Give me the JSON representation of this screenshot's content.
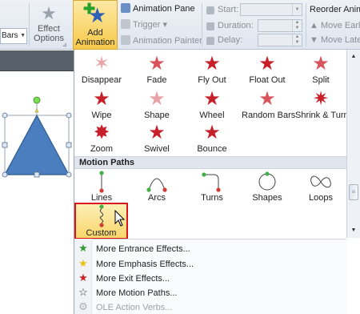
{
  "ribbon": {
    "bars_value": "Bars",
    "effect_options": {
      "line1": "Effect",
      "line2": "Options"
    },
    "add_animation": {
      "line1": "Add",
      "line2": "Animation"
    },
    "animation_pane": "Animation Pane",
    "trigger": "Trigger",
    "animation_painter": "Animation Painter",
    "start_label": "Start:",
    "duration_label": "Duration:",
    "delay_label": "Delay:",
    "reorder_label": "Reorder Anima",
    "move_earlier": "Move Earlie",
    "move_later": "Move Later"
  },
  "gallery": {
    "row1": [
      "Disappear",
      "Fade",
      "Fly Out",
      "Float Out",
      "Split"
    ],
    "row2": [
      "Wipe",
      "Shape",
      "Wheel",
      "Random Bars",
      "Shrink & Turn"
    ],
    "row3": [
      "Zoom",
      "Swivel",
      "Bounce"
    ],
    "motion_paths_header": "Motion Paths",
    "motion_paths": [
      "Lines",
      "Arcs",
      "Turns",
      "Shapes",
      "Loops"
    ],
    "custom_path": "Custom Path"
  },
  "menu": {
    "items": [
      {
        "label": "More Entrance Effects...",
        "icon": "green-star-icon",
        "enabled": true
      },
      {
        "label": "More Emphasis Effects...",
        "icon": "yellow-star-icon",
        "enabled": true
      },
      {
        "label": "More Exit Effects...",
        "icon": "red-star-icon",
        "enabled": true
      },
      {
        "label": "More Motion Paths...",
        "icon": "outline-star-icon",
        "enabled": true
      },
      {
        "label": "OLE Action Verbs...",
        "icon": "gear-icon",
        "enabled": false
      }
    ]
  },
  "colors": {
    "exit_star": "#c8202a",
    "highlight_border": "#d8161c",
    "triangle_fill": "#4a7ebf",
    "triangle_stroke": "#2f5a8f"
  }
}
